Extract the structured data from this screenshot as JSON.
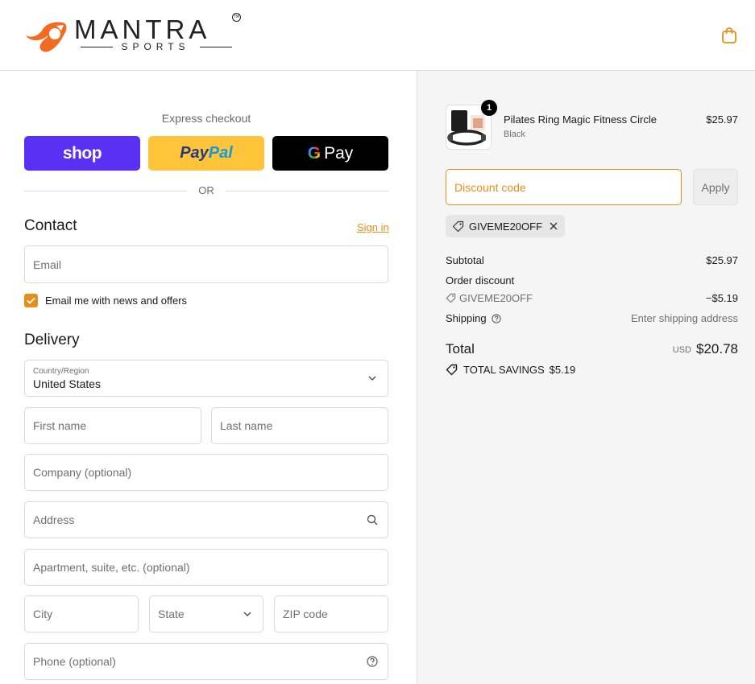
{
  "brand": {
    "name": "MANTRA",
    "sub": "SPORTS",
    "tm": "TM",
    "accent": "#e58f1a"
  },
  "express": {
    "label": "Express checkout",
    "shop_label": "shop",
    "paypal_pay": "Pay",
    "paypal_pal": "Pal",
    "gpay_g": "G",
    "gpay_pay": "Pay",
    "or_label": "OR"
  },
  "contact": {
    "title": "Contact",
    "signin_label": "Sign in",
    "email_placeholder": "Email",
    "news_label": "Email me with news and offers",
    "news_checked": true
  },
  "delivery": {
    "title": "Delivery",
    "country_label": "Country/Region",
    "country_value": "United States",
    "first_name": "First name",
    "last_name": "Last name",
    "company": "Company (optional)",
    "address": "Address",
    "apartment": "Apartment, suite, etc. (optional)",
    "city": "City",
    "state": "State",
    "zip": "ZIP code",
    "phone": "Phone (optional)"
  },
  "summary": {
    "item": {
      "qty": "1",
      "name": "Pilates Ring Magic Fitness Circle",
      "variant": "Black",
      "price": "$25.97"
    },
    "discount_placeholder": "Discount code",
    "apply_label": "Apply",
    "applied_code": "GIVEME20OFF",
    "subtotal_label": "Subtotal",
    "subtotal_value": "$25.97",
    "order_discount_label": "Order discount",
    "discount_code": "GIVEME20OFF",
    "discount_value": "−$5.19",
    "shipping_label": "Shipping",
    "shipping_value": "Enter shipping address",
    "total_label": "Total",
    "currency": "USD",
    "total_value": "$20.78",
    "savings_label": "TOTAL SAVINGS",
    "savings_value": "$5.19"
  }
}
